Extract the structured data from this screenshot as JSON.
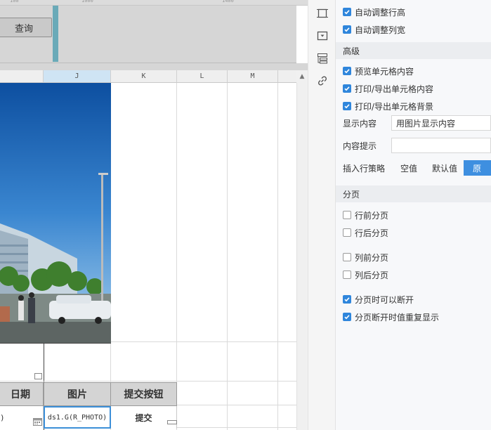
{
  "canvas": {
    "ruler_marks": [
      "100",
      "1000",
      "1400"
    ],
    "query_button_label": "查询",
    "columns": [
      "J",
      "K",
      "L",
      "M"
    ],
    "table_headers": [
      "日期",
      "图片",
      "提交按钮"
    ],
    "cells": {
      "date_formula": ")",
      "photo_formula": "ds1.G(R_PHOTO)",
      "submit_label": "提交"
    },
    "selection_color": "#3c8fd8"
  },
  "panel": {
    "adjust_row_height": {
      "label": "自动调整行高",
      "checked": true
    },
    "adjust_col_width": {
      "label": "自动调整列宽",
      "checked": true
    },
    "advanced_title": "高级",
    "preview_cell": {
      "label": "预览单元格内容",
      "checked": true
    },
    "print_cell": {
      "label": "打印/导出单元格内容",
      "checked": true
    },
    "print_bg": {
      "label": "打印/导出单元格背景",
      "checked": true
    },
    "display_content": {
      "label": "显示内容",
      "value": "用图片显示内容"
    },
    "content_hint": {
      "label": "内容提示",
      "value": ""
    },
    "insert_policy": {
      "label": "插入行策略",
      "options": [
        "空值",
        "默认值",
        "原"
      ],
      "selected": "原"
    },
    "pagination_title": "分页",
    "row_before": {
      "label": "行前分页",
      "checked": false
    },
    "row_after": {
      "label": "行后分页",
      "checked": false
    },
    "col_before": {
      "label": "列前分页",
      "checked": false
    },
    "col_after": {
      "label": "列后分页",
      "checked": false
    },
    "can_break": {
      "label": "分页时可以断开",
      "checked": true
    },
    "repeat_value": {
      "label": "分页断开时值重复显示",
      "checked": true
    },
    "accent_color": "#2f86dc"
  },
  "toolbar_icons": [
    "frame-icon",
    "dropdown-box-icon",
    "list-layout-icon",
    "link-icon"
  ]
}
